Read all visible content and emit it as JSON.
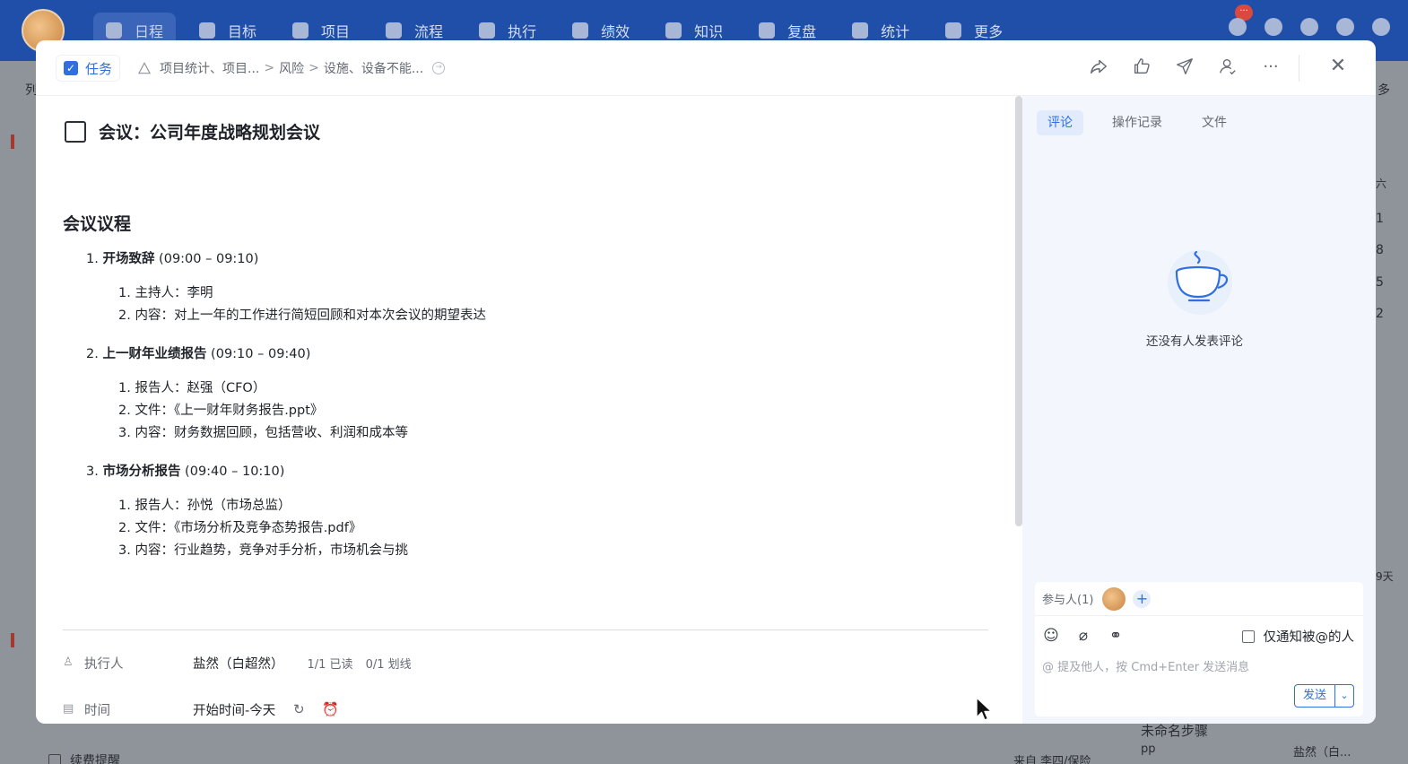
{
  "topnav": {
    "items": [
      {
        "label": "日程",
        "icon": "calendar-icon",
        "active": true
      },
      {
        "label": "目标",
        "icon": "target-icon",
        "active": false
      },
      {
        "label": "项目",
        "icon": "cube-icon",
        "active": false
      },
      {
        "label": "流程",
        "icon": "flow-icon",
        "active": false
      },
      {
        "label": "执行",
        "icon": "list-icon",
        "active": false
      },
      {
        "label": "绩效",
        "icon": "chart-icon",
        "active": false
      },
      {
        "label": "知识",
        "icon": "book-icon",
        "active": false
      },
      {
        "label": "复盘",
        "icon": "review-icon",
        "active": false
      },
      {
        "label": "统计",
        "icon": "pie-icon",
        "active": false
      },
      {
        "label": "更多",
        "icon": "grid-icon",
        "active": false
      }
    ],
    "notification_badge": "···"
  },
  "background": {
    "left_char": "列",
    "right_char_top": "多",
    "row1": "续费提醒",
    "row1_meta": "来自 李四/保险",
    "row2": "未命名步骤",
    "row2_sub": "pp",
    "row2_owner": "盐然（白...",
    "cal_day_header": "六",
    "cal_numbers": [
      "1",
      "8",
      "5",
      "2"
    ],
    "days_label": "9天"
  },
  "modal": {
    "task_tag": "任务",
    "breadcrumb": [
      "项目统计、项目...",
      "风险",
      "设施、设备不能..."
    ],
    "title": "会议：公司年度战略规划会议",
    "agenda_heading": "会议议程",
    "sections": [
      {
        "num": "1.",
        "title_bold": "开场致辞",
        "title_time": " (09:00 – 09:10)",
        "items": [
          "1. 主持人：李明",
          "2. 内容：对上一年的工作进行简短回顾和对本次会议的期望表达"
        ]
      },
      {
        "num": "2.",
        "title_bold": "上一财年业绩报告",
        "title_time": " (09:10 – 09:40)",
        "items": [
          "1. 报告人：赵强（CFO）",
          "2. 文件：《上一财年财务报告.ppt》",
          "3. 内容：财务数据回顾，包括营收、利润和成本等"
        ]
      },
      {
        "num": "3.",
        "title_bold": "市场分析报告",
        "title_time": " (09:40 – 10:10)",
        "items": [
          "1. 报告人：孙悦（市场总监）",
          "2. 文件：《市场分析及竞争态势报告.pdf》",
          "3. 内容：行业趋势，竞争对手分析，市场机会与挑"
        ]
      }
    ],
    "fields": {
      "assignee_label": "执行人",
      "assignee_value": "盐然（白超然）",
      "assignee_read": "1/1 已读",
      "assignee_strike": "0/1 划线",
      "time_label": "时间",
      "time_value": "开始时间-今天"
    },
    "right_panel": {
      "tabs": [
        "评论",
        "操作记录",
        "文件"
      ],
      "active_tab": 0,
      "empty_text": "还没有人发表评论",
      "participants_label": "参与人(1)",
      "notify_only_label": "仅通知被@的人",
      "placeholder": "@ 提及他人，按 Cmd+Enter 发送消息",
      "send_label": "发送"
    }
  }
}
